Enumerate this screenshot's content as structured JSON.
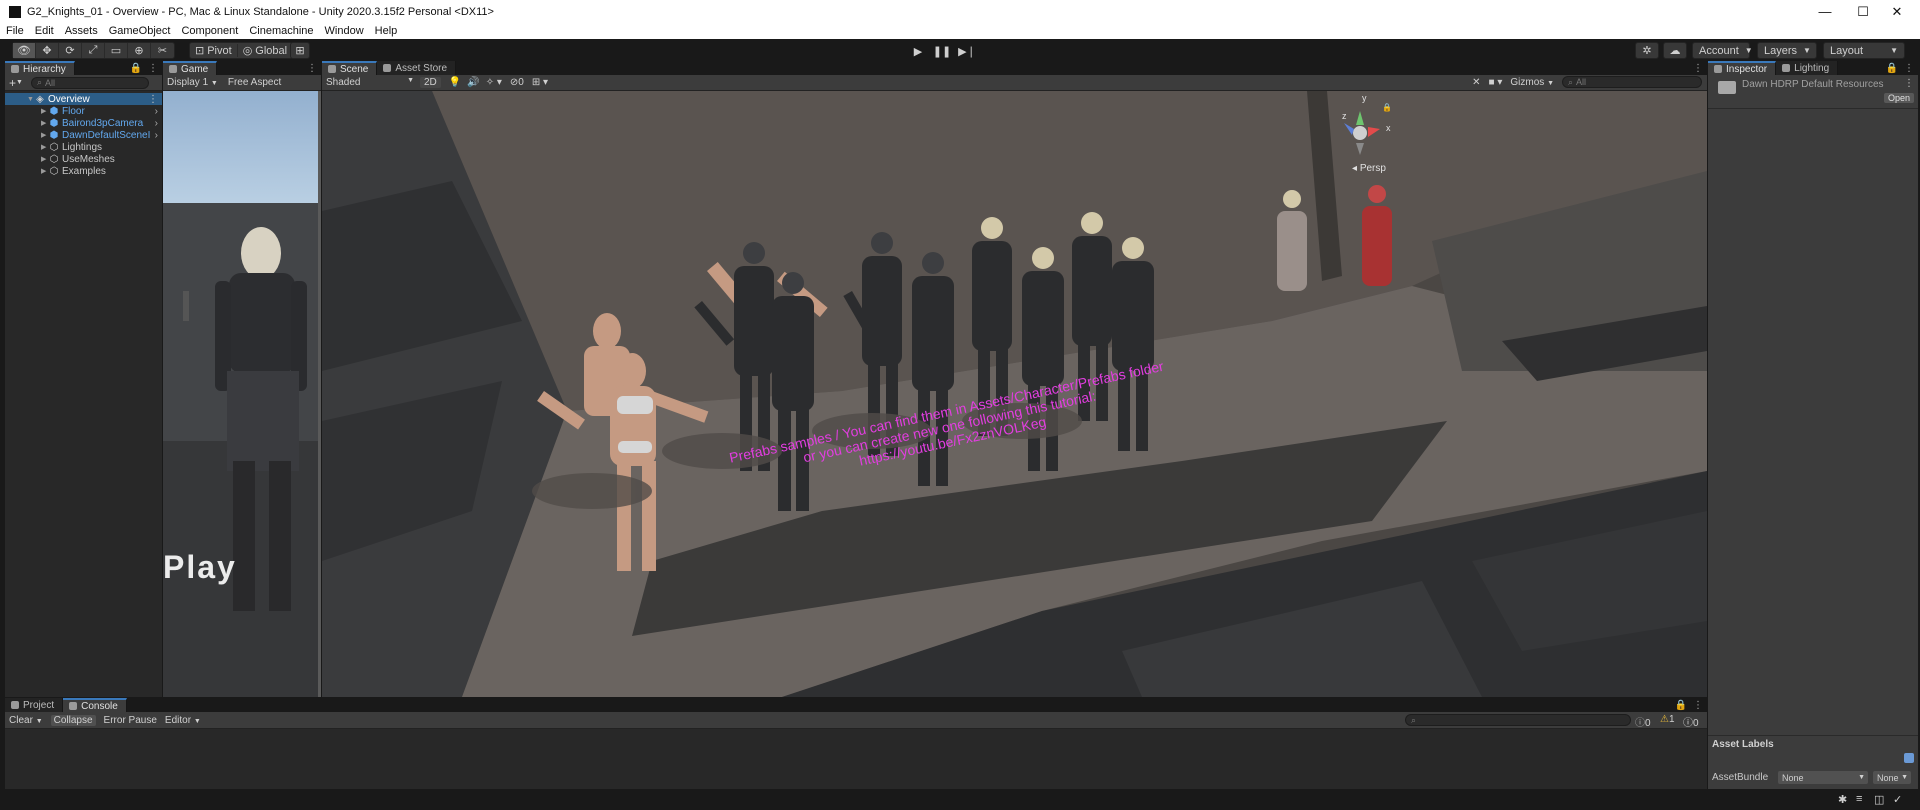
{
  "window": {
    "title": "G2_Knights_01 - Overview - PC, Mac & Linux Standalone - Unity 2020.3.15f2 Personal <DX11>",
    "minimize": "—",
    "maximize": "☐",
    "close": "✕"
  },
  "menu": [
    "File",
    "Edit",
    "Assets",
    "GameObject",
    "Component",
    "Cinemachine",
    "Window",
    "Help"
  ],
  "toolbar": {
    "pivot_label": "Pivot",
    "global_label": "Global",
    "account_label": "Account",
    "layers_label": "Layers",
    "layout_label": "Layout"
  },
  "hierarchy": {
    "tab_label": "Hierarchy",
    "search_placeholder": "All",
    "add_label": "+",
    "scene_name": "Overview",
    "items": [
      {
        "label": "Floor",
        "prefab": true
      },
      {
        "label": "Bairond3pCamera",
        "prefab": true
      },
      {
        "label": "DawnDefaultSceneI",
        "prefab": true
      },
      {
        "label": "Lightings",
        "prefab": false
      },
      {
        "label": "UseMeshes",
        "prefab": false
      },
      {
        "label": "Examples",
        "prefab": false
      }
    ]
  },
  "game": {
    "tab_label": "Game",
    "display_label": "Display 1",
    "aspect_label": "Free Aspect",
    "overlay_text": "Play"
  },
  "scene": {
    "tab_label": "Scene",
    "asset_store_tab": "Asset Store",
    "shading_mode": "Shaded",
    "mode_2d": "2D",
    "hidden_count": "0",
    "gizmos_label": "Gizmos",
    "search_placeholder": "All",
    "persp_label": "Persp",
    "axis_x": "x",
    "axis_y": "y",
    "axis_z": "z",
    "info_line1": "Prefabs samples / You can find them in Assets/Character/Prefabs folder",
    "info_line2": "or you can create new one following this tutorial:",
    "info_line3": "https://youtu.be/Fx2znVOLKeg"
  },
  "inspector": {
    "tab_label": "Inspector",
    "lighting_tab": "Lighting",
    "asset_name": "Dawn HDRP Default Resources",
    "open_label": "Open",
    "asset_labels_title": "Asset Labels",
    "asset_bundle_label": "AssetBundle",
    "bundle_value": "None",
    "variant_value": "None"
  },
  "console": {
    "project_tab": "Project",
    "console_tab": "Console",
    "clear_label": "Clear",
    "collapse_label": "Collapse",
    "error_pause_label": "Error Pause",
    "editor_label": "Editor",
    "log_count": "0",
    "warn_count": "1",
    "error_count": "0"
  },
  "colors": {
    "prefab_blue": "#62a8ee",
    "scene_text_magenta": "#e23ee0",
    "selection_blue": "#2c5d87"
  }
}
